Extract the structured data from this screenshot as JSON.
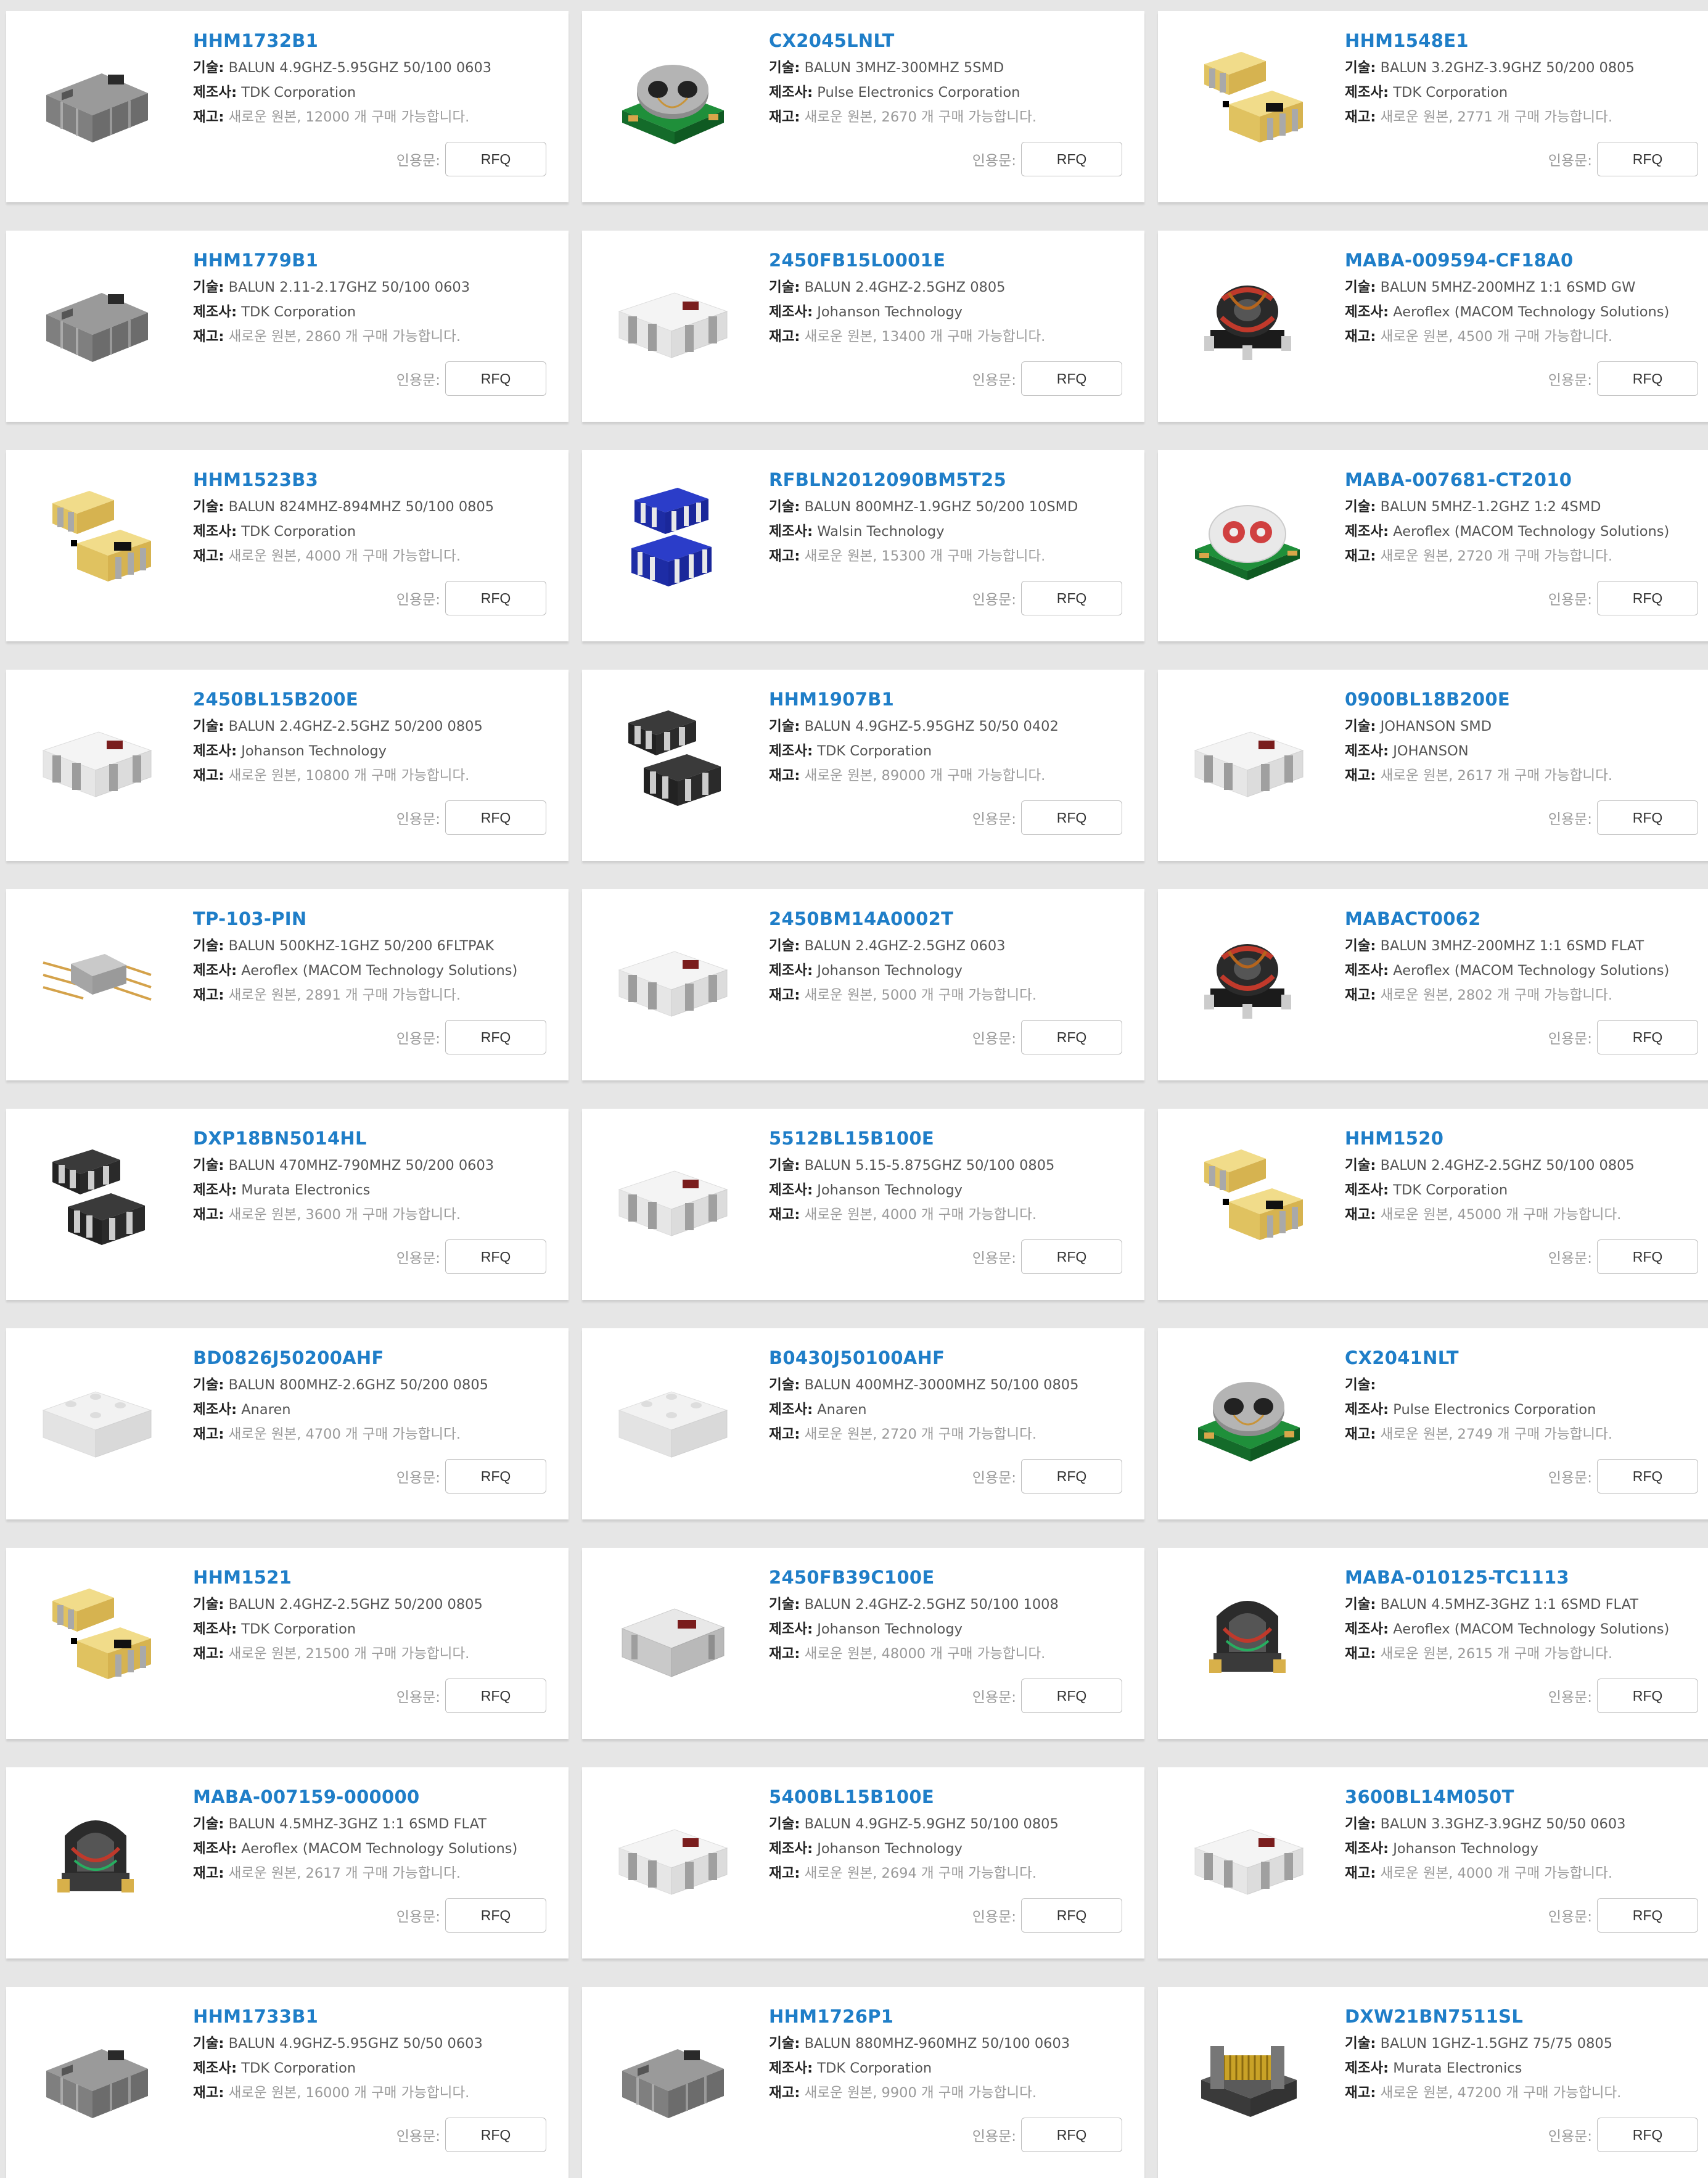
{
  "labels": {
    "tech": "기술:",
    "maker": "제조사:",
    "stock": "재고:",
    "quote": "인용문:",
    "rfq": "RFQ"
  },
  "products": [
    {
      "pn": "HHM1732B1",
      "tech": "BALUN 4.9GHZ-5.95GHZ 50/100 0603",
      "maker": "TDK Corporation",
      "stock": "새로운 원본, 12000 개 구매 가능합니다.",
      "thumb": "grey-chip"
    },
    {
      "pn": "CX2045LNLT",
      "tech": "BALUN 3MHZ-300MHZ 5SMD",
      "maker": "Pulse Electronics Corporation",
      "stock": "새로운 원본, 2670 개 구매 가능합니다.",
      "thumb": "binocular-core"
    },
    {
      "pn": "HHM1548E1",
      "tech": "BALUN 3.2GHZ-3.9GHZ 50/200 0805",
      "maker": "TDK Corporation",
      "stock": "새로운 원본, 2771 개 구매 가능합니다.",
      "thumb": "yellow-chips"
    },
    {
      "pn": "HHM1779B1",
      "tech": "BALUN 2.11-2.17GHZ 50/100 0603",
      "maker": "TDK Corporation",
      "stock": "새로운 원본, 2860 개 구매 가능합니다.",
      "thumb": "grey-chip"
    },
    {
      "pn": "2450FB15L0001E",
      "tech": "BALUN 2.4GHZ-2.5GHZ 0805",
      "maker": "Johanson Technology",
      "stock": "새로운 원본, 13400 개 구매 가능합니다.",
      "thumb": "white-chip"
    },
    {
      "pn": "MABA-009594-CF18A0",
      "tech": "BALUN 5MHZ-200MHZ 1:1 6SMD GW",
      "maker": "Aeroflex (MACOM Technology Solutions)",
      "stock": "새로운 원본, 4500 개 구매 가능합니다.",
      "thumb": "wound-transformer"
    },
    {
      "pn": "HHM1523B3",
      "tech": "BALUN 824MHZ-894MHZ 50/100 0805",
      "maker": "TDK Corporation",
      "stock": "새로운 원본, 4000 개 구매 가능합니다.",
      "thumb": "yellow-chips"
    },
    {
      "pn": "RFBLN2012090BM5T25",
      "tech": "BALUN 800MHZ-1.9GHZ 50/200 10SMD",
      "maker": "Walsin Technology",
      "stock": "새로운 원본, 15300 개 구매 가능합니다.",
      "thumb": "blue-chips"
    },
    {
      "pn": "MABA-007681-CT2010",
      "tech": "BALUN 5MHZ-1.2GHZ 1:2 4SMD",
      "maker": "Aeroflex (MACOM Technology Solutions)",
      "stock": "새로운 원본, 2720 개 구매 가능합니다.",
      "thumb": "dome-transformer"
    },
    {
      "pn": "2450BL15B200E",
      "tech": "BALUN 2.4GHZ-2.5GHZ 50/200 0805",
      "maker": "Johanson Technology",
      "stock": "새로운 원본, 10800 개 구매 가능합니다.",
      "thumb": "white-chip"
    },
    {
      "pn": "HHM1907B1",
      "tech": "BALUN 4.9GHZ-5.95GHZ 50/50 0402",
      "maker": "TDK Corporation",
      "stock": "새로운 원본, 89000 개 구매 가능합니다.",
      "thumb": "black-chips"
    },
    {
      "pn": "0900BL18B200E",
      "tech": "JOHANSON SMD",
      "maker": "JOHANSON",
      "stock": "새로운 원본, 2617 개 구매 가능합니다.",
      "thumb": "white-chip"
    },
    {
      "pn": "TP-103-PIN",
      "tech": "BALUN 500KHZ-1GHZ 50/200 6FLTPAK",
      "maker": "Aeroflex (MACOM Technology Solutions)",
      "stock": "새로운 원본, 2891 개 구매 가능합니다.",
      "thumb": "flatpak"
    },
    {
      "pn": "2450BM14A0002T",
      "tech": "BALUN 2.4GHZ-2.5GHZ 0603",
      "maker": "Johanson Technology",
      "stock": "새로운 원본, 5000 개 구매 가능합니다.",
      "thumb": "white-chip"
    },
    {
      "pn": "MABACT0062",
      "tech": "BALUN 3MHZ-200MHZ 1:1 6SMD FLAT",
      "maker": "Aeroflex (MACOM Technology Solutions)",
      "stock": "새로운 원본, 2802 개 구매 가능합니다.",
      "thumb": "wound-transformer"
    },
    {
      "pn": "DXP18BN5014HL",
      "tech": "BALUN 470MHZ-790MHZ 50/200 0603",
      "maker": "Murata Electronics",
      "stock": "새로운 원본, 3600 개 구매 가능합니다.",
      "thumb": "black-chips"
    },
    {
      "pn": "5512BL15B100E",
      "tech": "BALUN 5.15-5.875GHZ 50/100 0805",
      "maker": "Johanson Technology",
      "stock": "새로운 원본, 4000 개 구매 가능합니다.",
      "thumb": "white-chip"
    },
    {
      "pn": "HHM1520",
      "tech": "BALUN 2.4GHZ-2.5GHZ 50/100 0805",
      "maker": "TDK Corporation",
      "stock": "새로운 원본, 45000 개 구매 가능합니다.",
      "thumb": "yellow-chips"
    },
    {
      "pn": "BD0826J50200AHF",
      "tech": "BALUN 800MHZ-2.6GHZ 50/200 0805",
      "maker": "Anaren",
      "stock": "새로운 원본, 4700 개 구매 가능합니다.",
      "thumb": "plain-white-chip"
    },
    {
      "pn": "B0430J50100AHF",
      "tech": "BALUN 400MHZ-3000MHZ 50/100 0805",
      "maker": "Anaren",
      "stock": "새로운 원본, 2720 개 구매 가능합니다.",
      "thumb": "plain-white-chip"
    },
    {
      "pn": "CX2041NLT",
      "tech": "",
      "maker": "Pulse Electronics Corporation",
      "stock": "새로운 원본, 2749 개 구매 가능합니다.",
      "thumb": "binocular-core"
    },
    {
      "pn": "HHM1521",
      "tech": "BALUN 2.4GHZ-2.5GHZ 50/200 0805",
      "maker": "TDK Corporation",
      "stock": "새로운 원본, 21500 개 구매 가능합니다.",
      "thumb": "yellow-chips"
    },
    {
      "pn": "2450FB39C100E",
      "tech": "BALUN 2.4GHZ-2.5GHZ 50/100 1008",
      "maker": "Johanson Technology",
      "stock": "새로운 원본, 48000 개 구매 가능합니다.",
      "thumb": "grey-block"
    },
    {
      "pn": "MABA-010125-TC1113",
      "tech": "BALUN 4.5MHZ-3GHZ 1:1 6SMD FLAT",
      "maker": "Aeroflex (MACOM Technology Solutions)",
      "stock": "새로운 원본, 2615 개 구매 가능합니다.",
      "thumb": "ferrite-transformer"
    },
    {
      "pn": "MABA-007159-000000",
      "tech": "BALUN 4.5MHZ-3GHZ 1:1 6SMD FLAT",
      "maker": "Aeroflex (MACOM Technology Solutions)",
      "stock": "새로운 원본, 2617 개 구매 가능합니다.",
      "thumb": "ferrite-transformer"
    },
    {
      "pn": "5400BL15B100E",
      "tech": "BALUN 4.9GHZ-5.9GHZ 50/100 0805",
      "maker": "Johanson Technology",
      "stock": "새로운 원본, 2694 개 구매 가능합니다.",
      "thumb": "white-chip"
    },
    {
      "pn": "3600BL14M050T",
      "tech": "BALUN 3.3GHZ-3.9GHZ 50/50 0603",
      "maker": "Johanson Technology",
      "stock": "새로운 원본, 4000 개 구매 가능합니다.",
      "thumb": "white-chip"
    },
    {
      "pn": "HHM1733B1",
      "tech": "BALUN 4.9GHZ-5.95GHZ 50/50 0603",
      "maker": "TDK Corporation",
      "stock": "새로운 원본, 16000 개 구매 가능합니다.",
      "thumb": "grey-chip"
    },
    {
      "pn": "HHM1726P1",
      "tech": "BALUN 880MHZ-960MHZ 50/100 0603",
      "maker": "TDK Corporation",
      "stock": "새로운 원본, 9900 개 구매 가능합니다.",
      "thumb": "grey-chip"
    },
    {
      "pn": "DXW21BN7511SL",
      "tech": "BALUN 1GHZ-1.5GHZ 75/75 0805",
      "maker": "Murata Electronics",
      "stock": "새로운 원본, 47200 개 구매 가능합니다.",
      "thumb": "wirewound-chip"
    }
  ]
}
